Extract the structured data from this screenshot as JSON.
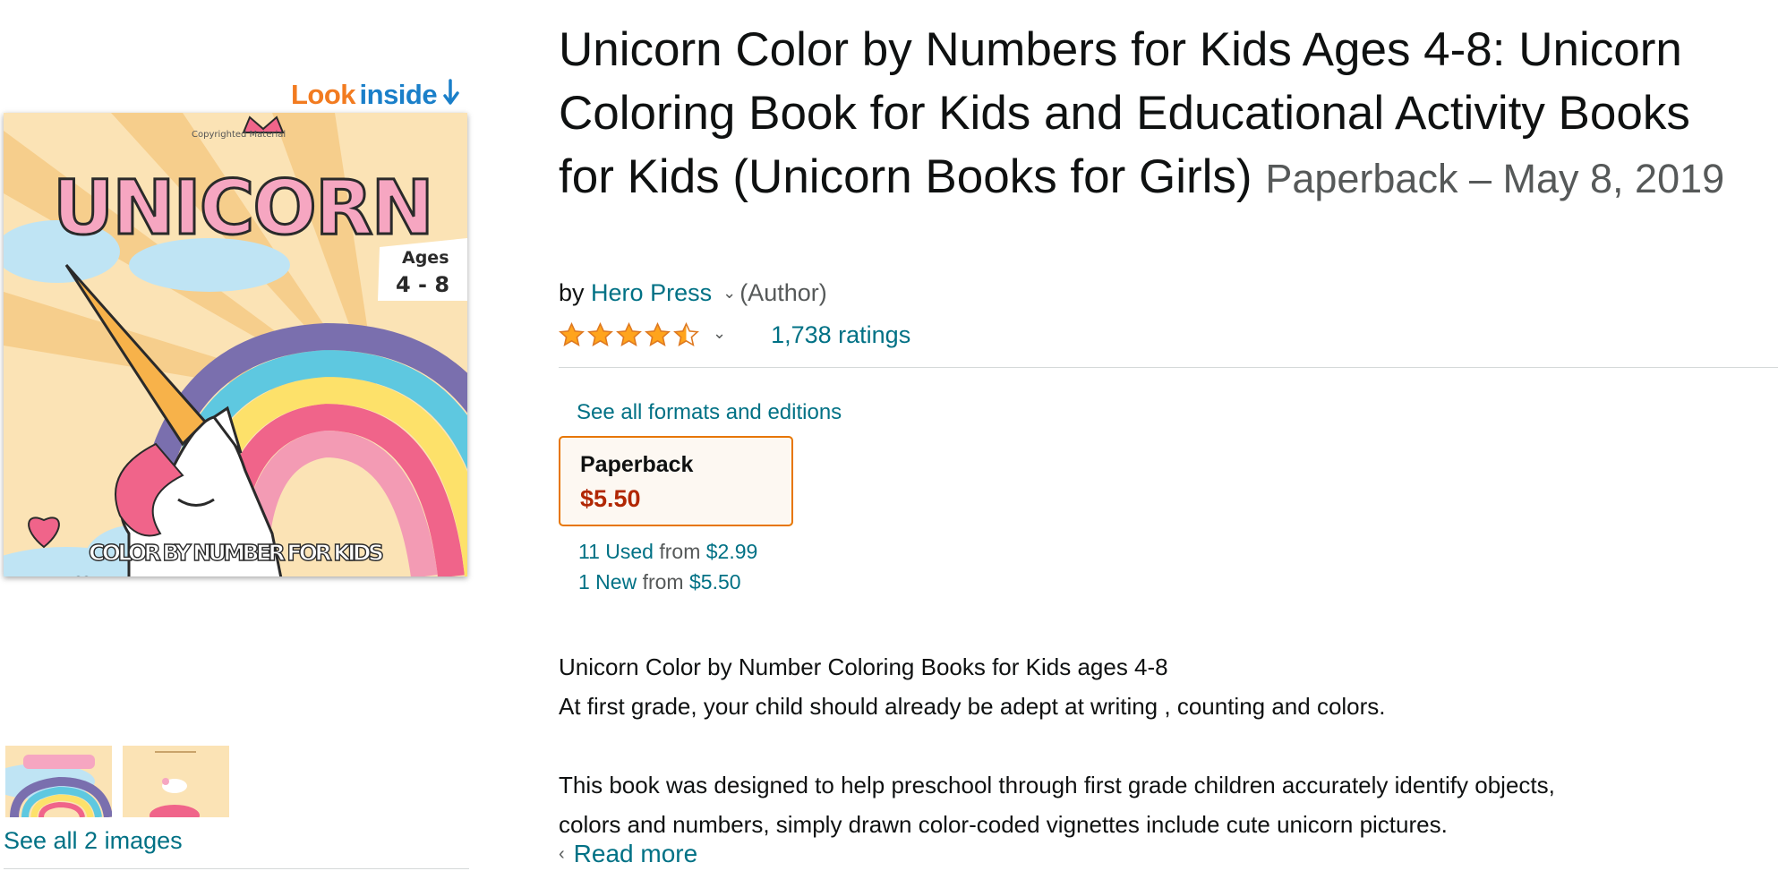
{
  "gallery": {
    "look_inside_word1": "Look",
    "look_inside_word2": "inside",
    "cover": {
      "copyright_text": "Copyrighted Material",
      "logo_text": "UNICORN",
      "ages_label": "Ages",
      "ages_range": "4 - 8",
      "footer_text": "COLOR BY NUMBER FOR KIDS"
    },
    "see_all_images": "See all 2 images"
  },
  "product": {
    "title": "Unicorn Color by Numbers for Kids Ages 4-8: Unicorn Coloring Book for Kids and Educational Activity Books for Kids (Unicorn Books for Girls)",
    "format_date": "Paperback – May 8, 2019",
    "by_label": "by",
    "author": "Hero Press",
    "author_role": "(Author)",
    "rating": 4.5,
    "ratings_count": "1,738 ratings"
  },
  "formats": {
    "see_all": "See all formats and editions",
    "selected": {
      "name": "Paperback",
      "price": "$5.50"
    },
    "used": {
      "label": "11 Used",
      "from": "from",
      "price": "$2.99"
    },
    "new": {
      "label": "1 New",
      "from": "from",
      "price": "$5.50"
    }
  },
  "description": {
    "line1": "Unicorn Color by Number Coloring Books for Kids ages 4-8",
    "line2": "At first grade, your child should already be adept at writing , counting and colors.",
    "line3": "This book was designed to help preschool through first grade children accurately identify objects,",
    "line4": "colors and numbers, simply drawn color-coded vignettes include cute unicorn pictures.",
    "read_more": "Read more"
  },
  "colors": {
    "link": "#007185",
    "price": "#b12704",
    "star": "#ffa41c",
    "selected_border": "#e77600",
    "look_orange": "#f27b20",
    "look_blue": "#1a7fc9"
  }
}
